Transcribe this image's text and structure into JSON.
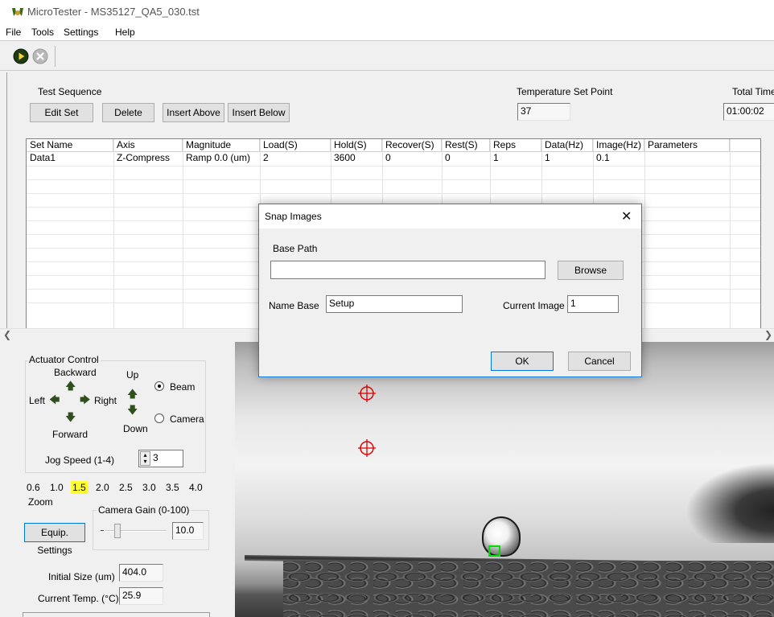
{
  "window": {
    "title": "MicroTester - MS35127_QA5_030.tst"
  },
  "menu": [
    "File",
    "Tools",
    "Settings",
    "Help"
  ],
  "toolbar": {
    "play_icon": "play-icon",
    "stop_icon": "stop-icon"
  },
  "sequence": {
    "label": "Test Sequence",
    "buttons": {
      "edit": "Edit Set",
      "delete": "Delete",
      "insert_above": "Insert Above",
      "insert_below": "Insert Below"
    },
    "columns": [
      "Set Name",
      "Axis",
      "Magnitude",
      "Load(S)",
      "Hold(S)",
      "Recover(S)",
      "Rest(S)",
      "Reps",
      "Data(Hz)",
      "Image(Hz)",
      "Parameters"
    ],
    "rows": [
      [
        "Data1",
        "Z-Compress",
        "Ramp 0.0 (um)",
        "2",
        "3600",
        "0",
        "0",
        "1",
        "1",
        "0.1",
        ""
      ]
    ]
  },
  "temperature": {
    "label": "Temperature Set Point",
    "value": "37"
  },
  "total_time": {
    "label": "Total Time",
    "value": "01:00:02"
  },
  "actuator": {
    "title": "Actuator Control",
    "backward": "Backward",
    "forward": "Forward",
    "left": "Left",
    "right": "Right",
    "up": "Up",
    "down": "Down",
    "beam": "Beam",
    "camera": "Camera",
    "selected": "Beam",
    "jog_label": "Jog Speed (1-4)",
    "jog_value": "3"
  },
  "zoom": {
    "levels": [
      "0.6",
      "1.0",
      "1.5",
      "2.0",
      "2.5",
      "3.0",
      "3.5",
      "4.0"
    ],
    "selected": "1.5",
    "label": "Zoom"
  },
  "camera_gain": {
    "title": "Camera Gain (0-100)",
    "value": "10.0",
    "level": 10
  },
  "equip_button": "Equip. Settings",
  "initial_size": {
    "label": "Initial Size (um)",
    "value": "404.0"
  },
  "current_temp": {
    "label": "Current Temp. (°C)",
    "value": "25.9"
  },
  "dialog": {
    "title": "Snap Images",
    "base_path_label": "Base Path",
    "base_path_value": "",
    "browse": "Browse",
    "name_base_label": "Name Base",
    "name_base_value": "Setup",
    "current_image_label": "Current Image",
    "current_image_value": "1",
    "ok": "OK",
    "cancel": "Cancel"
  }
}
